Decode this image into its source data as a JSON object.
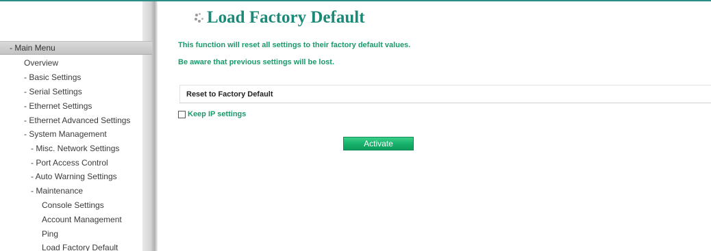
{
  "sidebar": {
    "header": "- Main Menu",
    "items": [
      {
        "label": "Overview"
      },
      {
        "label": "- Basic Settings"
      },
      {
        "label": "- Serial Settings"
      },
      {
        "label": "- Ethernet Settings"
      },
      {
        "label": "- Ethernet Advanced Settings"
      },
      {
        "label": "- System Management"
      },
      {
        "label": "- Misc. Network Settings"
      },
      {
        "label": "- Port Access Control"
      },
      {
        "label": "- Auto Warning Settings"
      },
      {
        "label": "- Maintenance"
      },
      {
        "label": "Console Settings"
      },
      {
        "label": "Account Management"
      },
      {
        "label": "Ping"
      },
      {
        "label": "Load Factory Default"
      }
    ]
  },
  "main": {
    "title": "Load Factory Default",
    "notice_line1": "This function will reset all settings to their factory default values.",
    "notice_line2": "Be aware that previous settings will be lost.",
    "section_title": "Reset to Factory Default",
    "keep_ip_label": "Keep IP settings",
    "keep_ip_checked": false,
    "activate_label": "Activate"
  },
  "colors": {
    "accent": "#1a8a78",
    "notice_text": "#1a9a6a",
    "button": "#17b26c"
  },
  "icons": {
    "title_bullet": "dots-icon",
    "checkbox": "checkbox-icon"
  }
}
